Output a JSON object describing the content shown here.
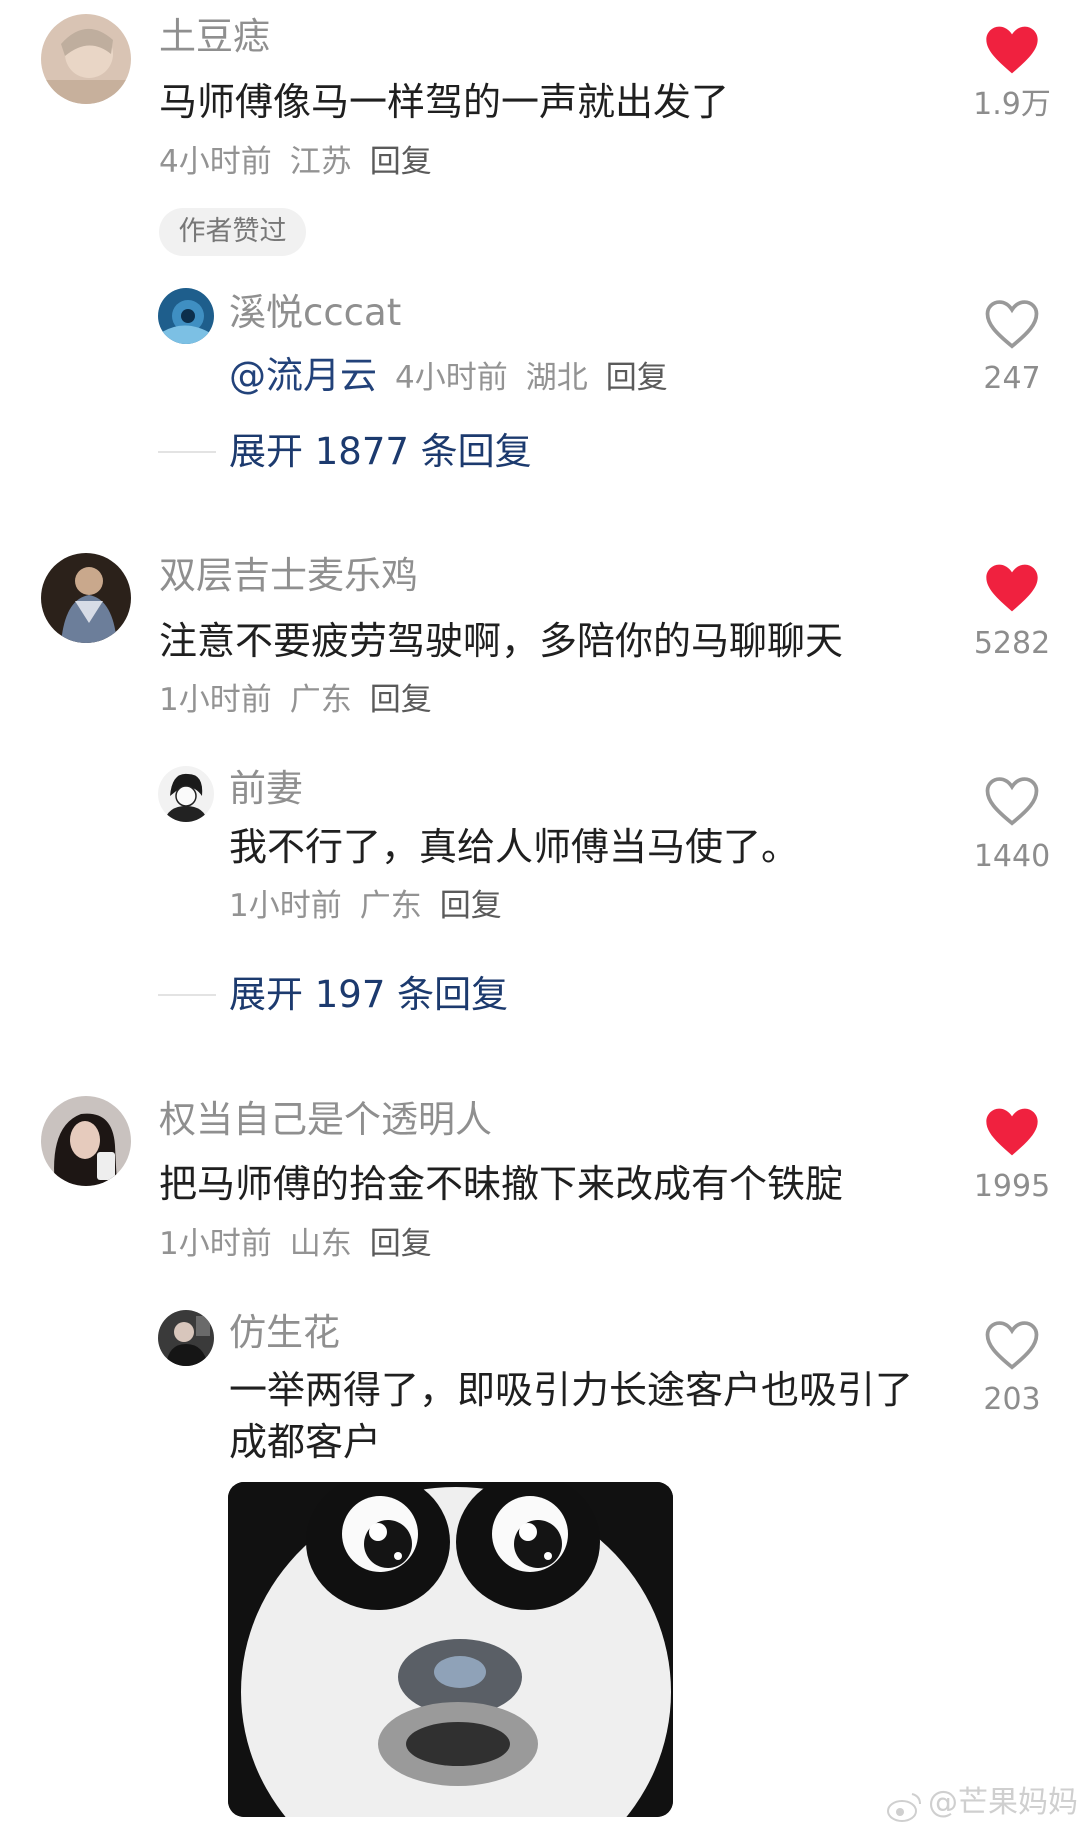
{
  "comments": [
    {
      "username": "土豆痣",
      "text": "马师傅像马一样驾的一声就出发了",
      "time": "4小时前",
      "location": "江苏",
      "reply_label": "回复",
      "likes": "1.9万",
      "liked": true,
      "badge": "作者赞过",
      "replies": [
        {
          "username": "溪悦cccat",
          "mention": "@流月云",
          "time": "4小时前",
          "location": "湖北",
          "reply_label": "回复",
          "likes": "247",
          "liked": false
        }
      ],
      "expand_label": "展开 1877 条回复"
    },
    {
      "username": "双层吉士麦乐鸡",
      "text": "注意不要疲劳驾驶啊，多陪你的马聊聊天",
      "time": "1小时前",
      "location": "广东",
      "reply_label": "回复",
      "likes": "5282",
      "liked": true,
      "replies": [
        {
          "username": "前妻",
          "text": "我不行了，真给人师傅当马使了。",
          "time": "1小时前",
          "location": "广东",
          "reply_label": "回复",
          "likes": "1440",
          "liked": false
        }
      ],
      "expand_label": "展开 197 条回复"
    },
    {
      "username": "权当自己是个透明人",
      "text": "把马师傅的拾金不昧撤下来改成有个铁腚",
      "time": "1小时前",
      "location": "山东",
      "reply_label": "回复",
      "likes": "1995",
      "liked": true,
      "replies": [
        {
          "username": "仿生花",
          "text": "一举两得了，即吸引力长途客户也吸引了成都客户",
          "likes": "203",
          "liked": false,
          "sticker": "panda-meme-sticker"
        }
      ]
    }
  ],
  "watermark": "@芒果妈妈",
  "colors": {
    "liked_heart": "#f0213f",
    "unliked_heart": "#999999",
    "link": "#22427a"
  }
}
